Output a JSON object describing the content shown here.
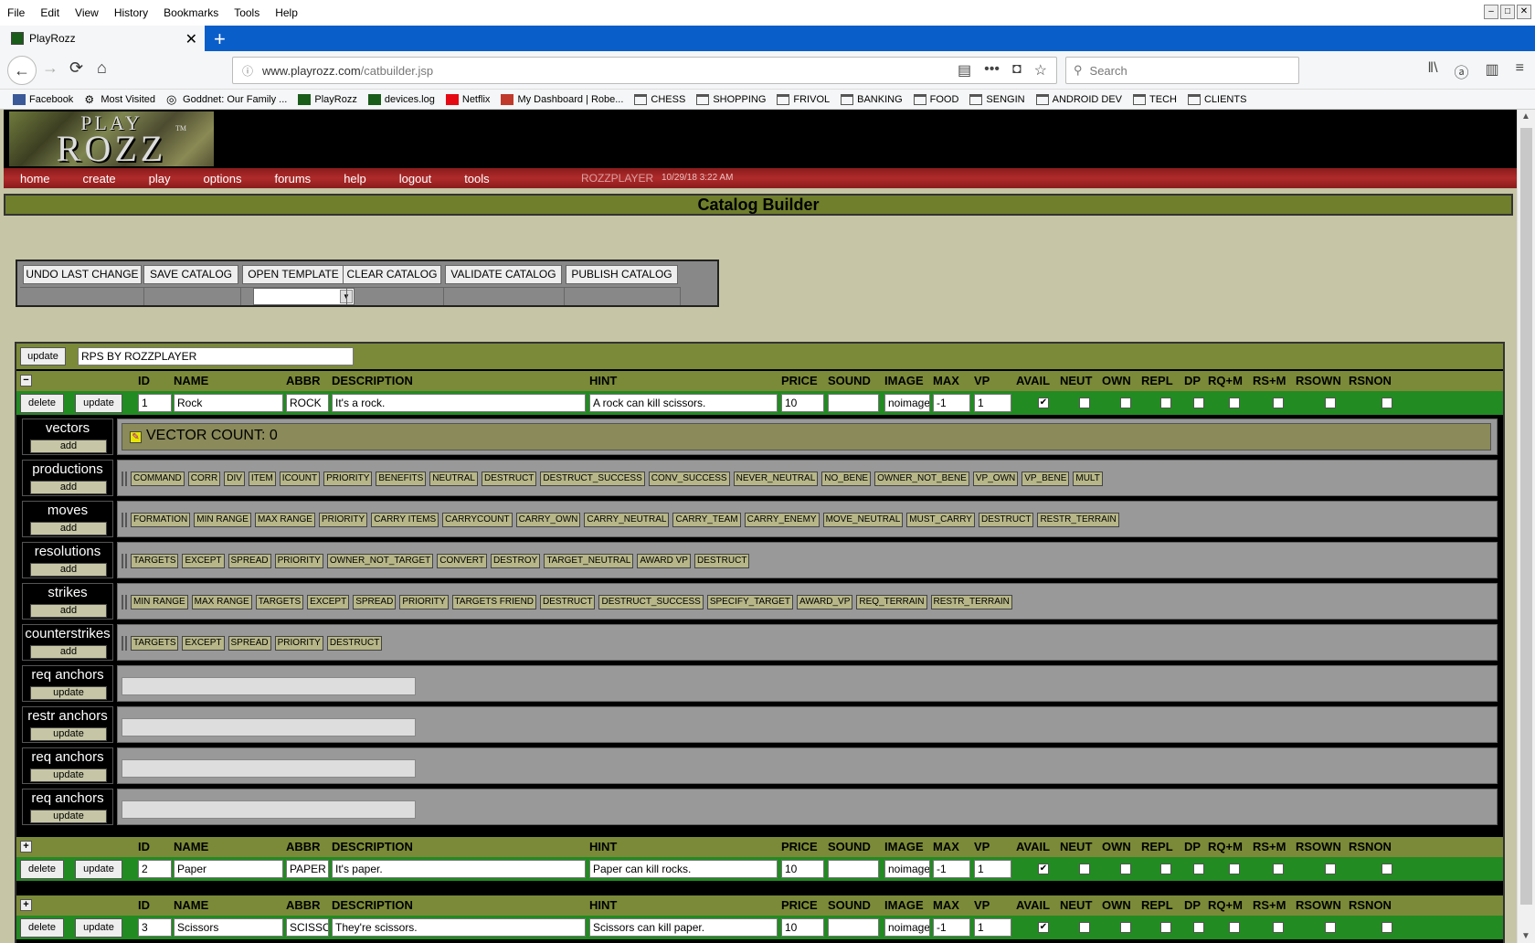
{
  "browser": {
    "menu": [
      "File",
      "Edit",
      "View",
      "History",
      "Bookmarks",
      "Tools",
      "Help"
    ],
    "tab_title": "PlayRozz",
    "url_host": "www.playrozz.com",
    "url_path": "/catbuilder.jsp",
    "search_placeholder": "Search",
    "bookmarks": [
      {
        "label": "Facebook",
        "icon": "facebook-icon",
        "color": "#3b5998"
      },
      {
        "label": "Most Visited",
        "icon": "gear-icon"
      },
      {
        "label": "Goddnet: Our Family ...",
        "icon": "globe-icon"
      },
      {
        "label": "PlayRozz",
        "icon": "playrozz-icon",
        "color": "#1a5c1a"
      },
      {
        "label": "devices.log",
        "icon": "playrozz-icon",
        "color": "#1a5c1a"
      },
      {
        "label": "Netflix",
        "icon": "netflix-icon",
        "color": "#e50914"
      },
      {
        "label": "My Dashboard | Robe...",
        "icon": "dashboard-icon",
        "color": "#c0392b"
      },
      {
        "label": "CHESS",
        "icon": "folder-icon"
      },
      {
        "label": "SHOPPING",
        "icon": "folder-icon"
      },
      {
        "label": "FRIVOL",
        "icon": "folder-icon"
      },
      {
        "label": "BANKING",
        "icon": "folder-icon"
      },
      {
        "label": "FOOD",
        "icon": "folder-icon"
      },
      {
        "label": "SENGIN",
        "icon": "folder-icon"
      },
      {
        "label": "ANDROID DEV",
        "icon": "folder-icon"
      },
      {
        "label": "TECH",
        "icon": "folder-icon"
      },
      {
        "label": "CLIENTS",
        "icon": "folder-icon"
      }
    ]
  },
  "site": {
    "logo_top": "PLAY",
    "logo_bottom": "ROZZ",
    "logo_tm": "TM",
    "nav": [
      "home",
      "create",
      "play",
      "options",
      "forums",
      "help",
      "logout",
      "tools"
    ],
    "username": "ROZZPLAYER",
    "timestamp": "10/29/18 3:22 AM",
    "page_title": "Catalog Builder"
  },
  "toolbox": {
    "buttons": [
      "UNDO LAST CHANGE",
      "SAVE CATALOG",
      "OPEN TEMPLATE",
      "CLEAR CATALOG",
      "VALIDATE CATALOG",
      "PUBLISH CATALOG"
    ],
    "template_selected": ""
  },
  "catalog": {
    "update_label": "update",
    "name": "RPS BY ROZZPLAYER",
    "columns": [
      "ID",
      "NAME",
      "ABBR",
      "DESCRIPTION",
      "HINT",
      "PRICE",
      "SOUND",
      "IMAGE",
      "MAX",
      "VP",
      "AVAIL",
      "NEUT",
      "OWN",
      "REPL",
      "DP",
      "RQ+M",
      "RS+M",
      "RSOWN",
      "RSNON"
    ],
    "delete_label": "delete",
    "items": [
      {
        "toggle": "−",
        "id": "1",
        "name": "Rock",
        "abbr": "ROCK",
        "description": "It's a rock.",
        "hint": "A rock can kill scissors.",
        "price": "10",
        "sound": "",
        "image": "noimage",
        "max": "-1",
        "vp": "1",
        "checks": [
          true,
          false,
          false,
          false,
          false,
          false,
          false,
          false,
          false
        ]
      },
      {
        "toggle": "+",
        "id": "2",
        "name": "Paper",
        "abbr": "PAPER",
        "description": "It's paper.",
        "hint": "Paper can kill rocks.",
        "price": "10",
        "sound": "",
        "image": "noimage",
        "max": "-1",
        "vp": "1",
        "checks": [
          true,
          false,
          false,
          false,
          false,
          false,
          false,
          false,
          false
        ]
      },
      {
        "toggle": "+",
        "id": "3",
        "name": "Scissors",
        "abbr": "SCISSO",
        "description": "They're scissors.",
        "hint": "Scissors can kill paper.",
        "price": "10",
        "sound": "",
        "image": "noimage",
        "max": "-1",
        "vp": "1",
        "checks": [
          true,
          false,
          false,
          false,
          false,
          false,
          false,
          false,
          false
        ]
      }
    ]
  },
  "details": {
    "vector_count": "VECTOR COUNT: 0",
    "sections": [
      {
        "label": "vectors",
        "button": "add",
        "kind": "vectors"
      },
      {
        "label": "productions",
        "button": "add",
        "kind": "tags",
        "tags": [
          "COMMAND",
          "CORR",
          "DIV",
          "ITEM",
          "ICOUNT",
          "PRIORITY",
          "BENEFITS",
          "NEUTRAL",
          "DESTRUCT",
          "DESTRUCT_SUCCESS",
          "CONV_SUCCESS",
          "NEVER_NEUTRAL",
          "NO_BENE",
          "OWNER_NOT_BENE",
          "VP_OWN",
          "VP_BENE",
          "MULT"
        ]
      },
      {
        "label": "moves",
        "button": "add",
        "kind": "tags",
        "tags": [
          "FORMATION",
          "MIN RANGE",
          "MAX RANGE",
          "PRIORITY",
          "CARRY ITEMS",
          "CARRYCOUNT",
          "CARRY_OWN",
          "CARRY_NEUTRAL",
          "CARRY_TEAM",
          "CARRY_ENEMY",
          "MOVE_NEUTRAL",
          "MUST_CARRY",
          "DESTRUCT",
          "RESTR_TERRAIN"
        ]
      },
      {
        "label": "resolutions",
        "button": "add",
        "kind": "tags",
        "tags": [
          "TARGETS",
          "EXCEPT",
          "SPREAD",
          "PRIORITY",
          "OWNER_NOT_TARGET",
          "CONVERT",
          "DESTROY",
          "TARGET_NEUTRAL",
          "AWARD VP",
          "DESTRUCT"
        ]
      },
      {
        "label": "strikes",
        "button": "add",
        "kind": "tags",
        "tags": [
          "MIN RANGE",
          "MAX RANGE",
          "TARGETS",
          "EXCEPT",
          "SPREAD",
          "PRIORITY",
          "TARGETS FRIEND",
          "DESTRUCT",
          "DESTRUCT_SUCCESS",
          "SPECIFY_TARGET",
          "AWARD_VP",
          "REQ_TERRAIN",
          "RESTR_TERRAIN"
        ]
      },
      {
        "label": "counterstrikes",
        "button": "add",
        "kind": "tags",
        "tags": [
          "TARGETS",
          "EXCEPT",
          "SPREAD",
          "PRIORITY",
          "DESTRUCT"
        ]
      },
      {
        "label": "req anchors",
        "button": "update",
        "kind": "anchor"
      },
      {
        "label": "restr anchors",
        "button": "update",
        "kind": "anchor"
      },
      {
        "label": "req anchors",
        "button": "update",
        "kind": "anchor"
      },
      {
        "label": "req anchors",
        "button": "update",
        "kind": "anchor"
      }
    ]
  }
}
